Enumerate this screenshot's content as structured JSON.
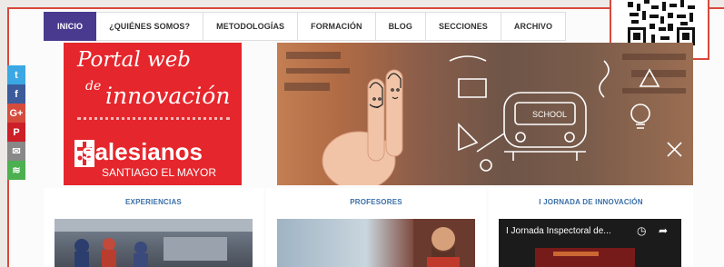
{
  "nav": {
    "items": [
      {
        "label": "INICIO",
        "active": true
      },
      {
        "label": "¿QUIÉNES SOMOS?",
        "active": false
      },
      {
        "label": "METODOLOGÍAS",
        "active": false
      },
      {
        "label": "FORMACIÓN",
        "active": false
      },
      {
        "label": "BLOG",
        "active": false
      },
      {
        "label": "SECCIONES",
        "active": false
      },
      {
        "label": "ARCHIVO",
        "active": false
      }
    ]
  },
  "share": {
    "items": [
      {
        "icon": "twitter-icon",
        "glyph": "t"
      },
      {
        "icon": "facebook-icon",
        "glyph": "f"
      },
      {
        "icon": "google-plus-icon",
        "glyph": "G+"
      },
      {
        "icon": "pinterest-icon",
        "glyph": "P"
      },
      {
        "icon": "email-icon",
        "glyph": "✉"
      },
      {
        "icon": "share-icon",
        "glyph": "≋"
      }
    ]
  },
  "logo": {
    "line1": "Portal web",
    "line2": "de",
    "line3": "innovación",
    "brand": "salesianos",
    "brand_sub": "SANTIAGO EL MAYOR"
  },
  "hero": {
    "board_text": "SCHOOL"
  },
  "sections": [
    {
      "title": "EXPERIENCIAS"
    },
    {
      "title": "PROFESORES"
    },
    {
      "title": "I JORNADA DE INNOVACIÓN",
      "video_title": "I Jornada Inspectoral de..."
    }
  ],
  "colors": {
    "nav_active": "#4a3a8f",
    "brand_red": "#e5262c",
    "section_title": "#3a6fa8",
    "frame": "#d9483b"
  }
}
